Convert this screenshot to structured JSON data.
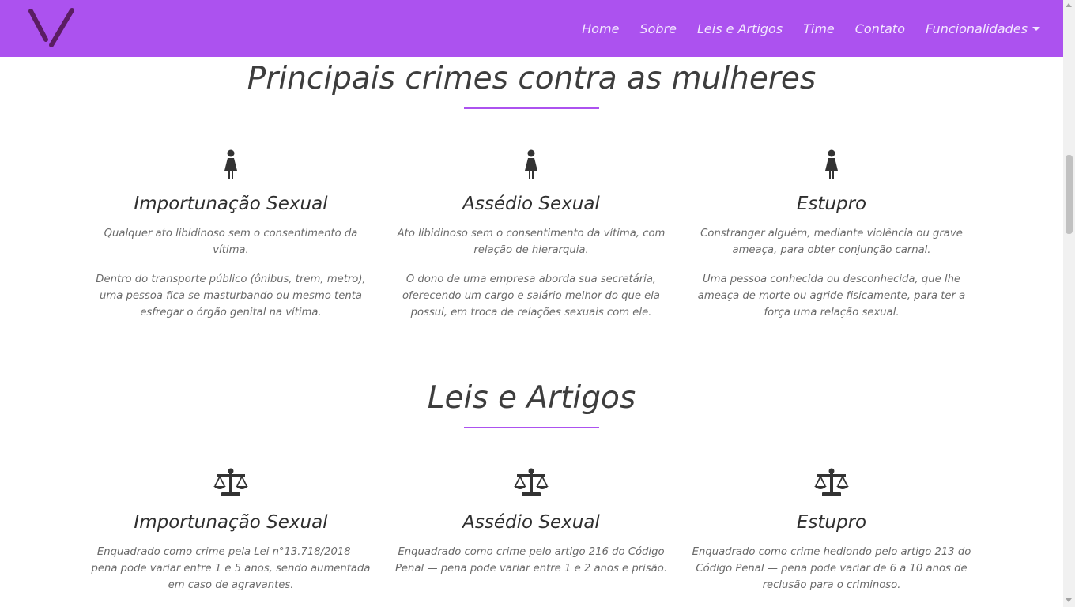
{
  "colors": {
    "accent": "#ac52ef",
    "logo": "#5a1d62",
    "text": "#333333"
  },
  "navbar": {
    "logo_icon": "v-logo-icon",
    "links": [
      "Home",
      "Sobre",
      "Leis e Artigos",
      "Time",
      "Contato"
    ],
    "dropdown_label": "Funcionalidades"
  },
  "crimes": {
    "title": "Principais crimes contra as mulheres",
    "icon": "female-icon",
    "cards": [
      {
        "title": "Importunação Sexual",
        "description": "Qualquer ato libidinoso sem o consentimento da vítima.",
        "example": "Dentro do transporte público (ônibus, trem, metro), uma pessoa fica se masturbando ou mesmo tenta esfregar o órgão genital na vítima."
      },
      {
        "title": "Assédio Sexual",
        "description": "Ato libidinoso sem o consentimento da vítima, com relação de hierarquia.",
        "example": "O dono de uma empresa aborda sua secretária, oferecendo um cargo e salário melhor do que ela possui, em troca de relações sexuais com ele."
      },
      {
        "title": "Estupro",
        "description": "Constranger alguém, mediante violência ou grave ameaça, para obter conjunção carnal.",
        "example": "Uma pessoa conhecida ou desconhecida, que lhe ameaça de morte ou agride fisicamente, para ter a força uma relação sexual."
      }
    ]
  },
  "laws": {
    "title": "Leis e Artigos",
    "icon": "balance-scale-icon",
    "cards": [
      {
        "title": "Importunação Sexual",
        "description": "Enquadrado como crime pela Lei n°13.718/2018 — pena pode variar entre 1 e 5 anos, sendo aumentada em caso de agravantes."
      },
      {
        "title": "Assédio Sexual",
        "description": "Enquadrado como crime pelo artigo 216 do Código Penal — pena pode variar entre 1 e 2 anos e prisão."
      },
      {
        "title": "Estupro",
        "description": "Enquadrado como crime hediondo pelo artigo 213 do Código Penal — pena pode variar de 6 a 10 anos de reclusão para o criminoso."
      }
    ]
  }
}
